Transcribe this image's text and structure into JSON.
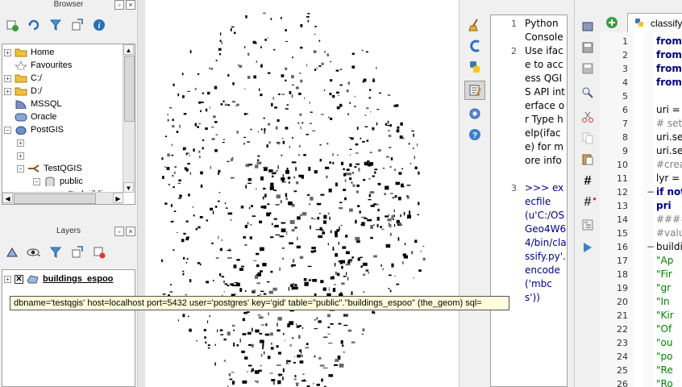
{
  "browser": {
    "title": "Browser",
    "items": [
      {
        "label": "Home"
      },
      {
        "label": "Favourites"
      },
      {
        "label": "C:/"
      },
      {
        "label": "D:/"
      },
      {
        "label": "MSSQL"
      },
      {
        "label": "Oracle"
      },
      {
        "label": "PostGIS"
      },
      {
        "label": ""
      },
      {
        "label": ""
      },
      {
        "label": "TestQGIS"
      },
      {
        "label": "public"
      },
      {
        "label": "buildings_"
      }
    ]
  },
  "layers": {
    "title": "Layers",
    "items": [
      {
        "label": "buildings_espoo"
      }
    ]
  },
  "tooltip": {
    "text": "dbname='testqgis' host=localhost port=5432 user='postgres' key='gid' table=\"public\".\"buildings_espoo\" (the_geom) sql="
  },
  "console": {
    "lines": [
      {
        "num": "1",
        "text": "Python Console"
      },
      {
        "num": "2",
        "text": "Use iface to access QGIS API interface or Type help(iface) for more info"
      },
      {
        "num": "3",
        "text": ">>> execfile(u'C:/OSGeo4W64/bin/classify.py'.encode('mbcs'))"
      }
    ]
  },
  "editor": {
    "tab": "classify.",
    "lines": [
      {
        "num": "1",
        "fold": "",
        "text": "from",
        "cls": "kw"
      },
      {
        "num": "2",
        "fold": "",
        "text": "from",
        "cls": "kw"
      },
      {
        "num": "3",
        "fold": "",
        "text": "from",
        "cls": "kw"
      },
      {
        "num": "4",
        "fold": "",
        "text": "from",
        "cls": "kw"
      },
      {
        "num": "5",
        "fold": "",
        "text": "",
        "cls": ""
      },
      {
        "num": "6",
        "fold": "",
        "text": "uri =",
        "cls": ""
      },
      {
        "num": "7",
        "fold": "",
        "text": "# set",
        "cls": "cm"
      },
      {
        "num": "8",
        "fold": "",
        "text": "uri.se",
        "cls": ""
      },
      {
        "num": "9",
        "fold": "",
        "text": "uri.se",
        "cls": ""
      },
      {
        "num": "10",
        "fold": "",
        "text": "#crea",
        "cls": "cm"
      },
      {
        "num": "11",
        "fold": "",
        "text": "lyr =",
        "cls": ""
      },
      {
        "num": "12",
        "fold": "−",
        "text": "if not",
        "cls": "kw"
      },
      {
        "num": "13",
        "fold": "",
        "text": "   pri",
        "cls": "kw"
      },
      {
        "num": "14",
        "fold": "",
        "text": "####",
        "cls": "cm"
      },
      {
        "num": "15",
        "fold": "",
        "text": "#valu",
        "cls": "cm"
      },
      {
        "num": "16",
        "fold": "−",
        "text": "buildi",
        "cls": ""
      },
      {
        "num": "17",
        "fold": "",
        "text": "  \"Ap",
        "cls": "str"
      },
      {
        "num": "18",
        "fold": "",
        "text": "  \"Fir",
        "cls": "str"
      },
      {
        "num": "19",
        "fold": "",
        "text": "  \"gr",
        "cls": "str"
      },
      {
        "num": "20",
        "fold": "",
        "text": "  \"In",
        "cls": "str"
      },
      {
        "num": "21",
        "fold": "",
        "text": "  \"Kir",
        "cls": "str"
      },
      {
        "num": "22",
        "fold": "",
        "text": "  \"Of",
        "cls": "str"
      },
      {
        "num": "23",
        "fold": "",
        "text": "  \"ou",
        "cls": "str"
      },
      {
        "num": "24",
        "fold": "",
        "text": "  \"po",
        "cls": "str"
      },
      {
        "num": "25",
        "fold": "",
        "text": "  \"Re",
        "cls": "str"
      },
      {
        "num": "26",
        "fold": "",
        "text": "  \"Ro",
        "cls": "str"
      }
    ]
  },
  "colors": {
    "keyword": "#00007f",
    "string": "#007f00",
    "comment": "#7f7f7f"
  }
}
